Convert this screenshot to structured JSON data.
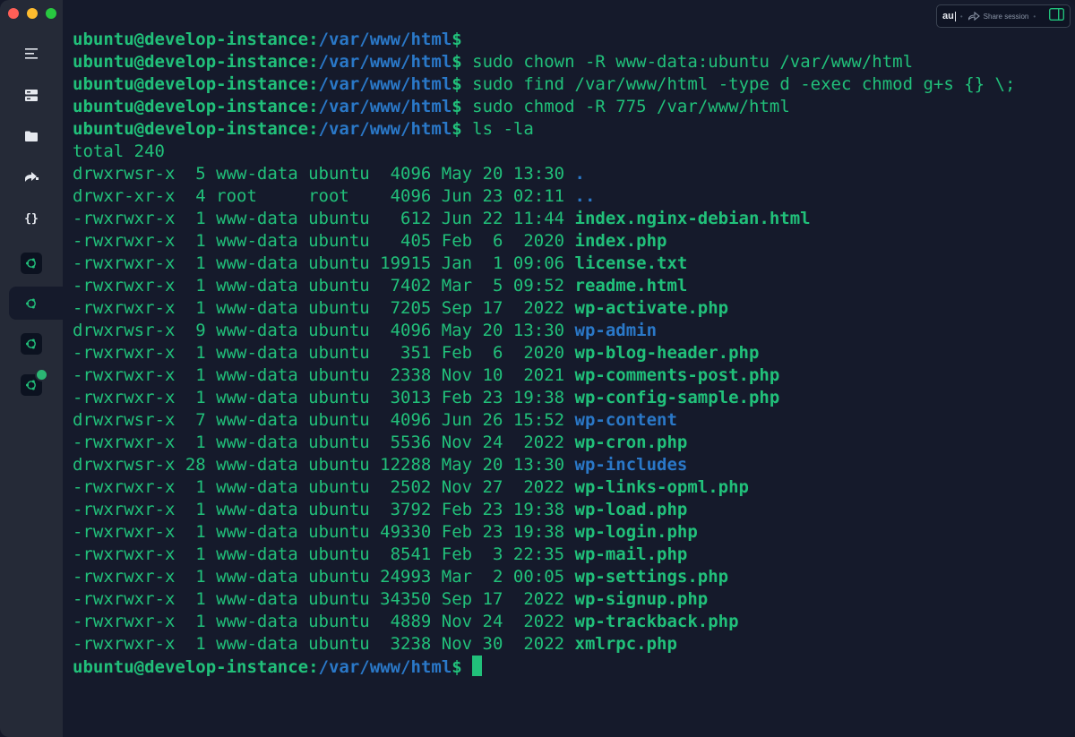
{
  "window": {
    "colors": {
      "bg": "#151a2b",
      "sidebar": "#252a37",
      "green": "#21c07a",
      "blue": "#2a78c8"
    }
  },
  "sidebar": {
    "items": [
      {
        "icon": "menu-icon"
      },
      {
        "icon": "hosts-icon"
      },
      {
        "icon": "folder-icon"
      },
      {
        "icon": "port-forward-icon"
      },
      {
        "icon": "snippets-icon"
      },
      {
        "icon": "ubuntu-host-icon"
      },
      {
        "icon": "ubuntu-host-icon"
      },
      {
        "icon": "ubuntu-host-icon"
      },
      {
        "icon": "ubuntu-host-icon"
      }
    ]
  },
  "topbar": {
    "au_label": "au",
    "share_label": "Share session"
  },
  "terminal": {
    "user_host": "ubuntu@develop-instance:",
    "path": "/var/www/html",
    "prompt_end": "$",
    "commands": [
      "",
      " sudo chown -R www-data:ubuntu /var/www/html",
      " sudo find /var/www/html -type d -exec chmod g+s {} \\;",
      " sudo chmod -R 775 /var/www/html",
      " ls -la"
    ],
    "total_line": "total 240",
    "listing": [
      {
        "meta": "drwxrwsr-x  5 www-data ubuntu  4096 May 20 13:30 ",
        "name": ".",
        "dir": true
      },
      {
        "meta": "drwxr-xr-x  4 root     root    4096 Jun 23 02:11 ",
        "name": "..",
        "dir": true
      },
      {
        "meta": "-rwxrwxr-x  1 www-data ubuntu   612 Jun 22 11:44 ",
        "name": "index.nginx-debian.html",
        "dir": false
      },
      {
        "meta": "-rwxrwxr-x  1 www-data ubuntu   405 Feb  6  2020 ",
        "name": "index.php",
        "dir": false
      },
      {
        "meta": "-rwxrwxr-x  1 www-data ubuntu 19915 Jan  1 09:06 ",
        "name": "license.txt",
        "dir": false
      },
      {
        "meta": "-rwxrwxr-x  1 www-data ubuntu  7402 Mar  5 09:52 ",
        "name": "readme.html",
        "dir": false
      },
      {
        "meta": "-rwxrwxr-x  1 www-data ubuntu  7205 Sep 17  2022 ",
        "name": "wp-activate.php",
        "dir": false
      },
      {
        "meta": "drwxrwsr-x  9 www-data ubuntu  4096 May 20 13:30 ",
        "name": "wp-admin",
        "dir": true
      },
      {
        "meta": "-rwxrwxr-x  1 www-data ubuntu   351 Feb  6  2020 ",
        "name": "wp-blog-header.php",
        "dir": false
      },
      {
        "meta": "-rwxrwxr-x  1 www-data ubuntu  2338 Nov 10  2021 ",
        "name": "wp-comments-post.php",
        "dir": false
      },
      {
        "meta": "-rwxrwxr-x  1 www-data ubuntu  3013 Feb 23 19:38 ",
        "name": "wp-config-sample.php",
        "dir": false
      },
      {
        "meta": "drwxrwsr-x  7 www-data ubuntu  4096 Jun 26 15:52 ",
        "name": "wp-content",
        "dir": true
      },
      {
        "meta": "-rwxrwxr-x  1 www-data ubuntu  5536 Nov 24  2022 ",
        "name": "wp-cron.php",
        "dir": false
      },
      {
        "meta": "drwxrwsr-x 28 www-data ubuntu 12288 May 20 13:30 ",
        "name": "wp-includes",
        "dir": true
      },
      {
        "meta": "-rwxrwxr-x  1 www-data ubuntu  2502 Nov 27  2022 ",
        "name": "wp-links-opml.php",
        "dir": false
      },
      {
        "meta": "-rwxrwxr-x  1 www-data ubuntu  3792 Feb 23 19:38 ",
        "name": "wp-load.php",
        "dir": false
      },
      {
        "meta": "-rwxrwxr-x  1 www-data ubuntu 49330 Feb 23 19:38 ",
        "name": "wp-login.php",
        "dir": false
      },
      {
        "meta": "-rwxrwxr-x  1 www-data ubuntu  8541 Feb  3 22:35 ",
        "name": "wp-mail.php",
        "dir": false
      },
      {
        "meta": "-rwxrwxr-x  1 www-data ubuntu 24993 Mar  2 00:05 ",
        "name": "wp-settings.php",
        "dir": false
      },
      {
        "meta": "-rwxrwxr-x  1 www-data ubuntu 34350 Sep 17  2022 ",
        "name": "wp-signup.php",
        "dir": false
      },
      {
        "meta": "-rwxrwxr-x  1 www-data ubuntu  4889 Nov 24  2022 ",
        "name": "wp-trackback.php",
        "dir": false
      },
      {
        "meta": "-rwxrwxr-x  1 www-data ubuntu  3238 Nov 30  2022 ",
        "name": "xmlrpc.php",
        "dir": false
      }
    ],
    "final_prompt_command": " "
  }
}
